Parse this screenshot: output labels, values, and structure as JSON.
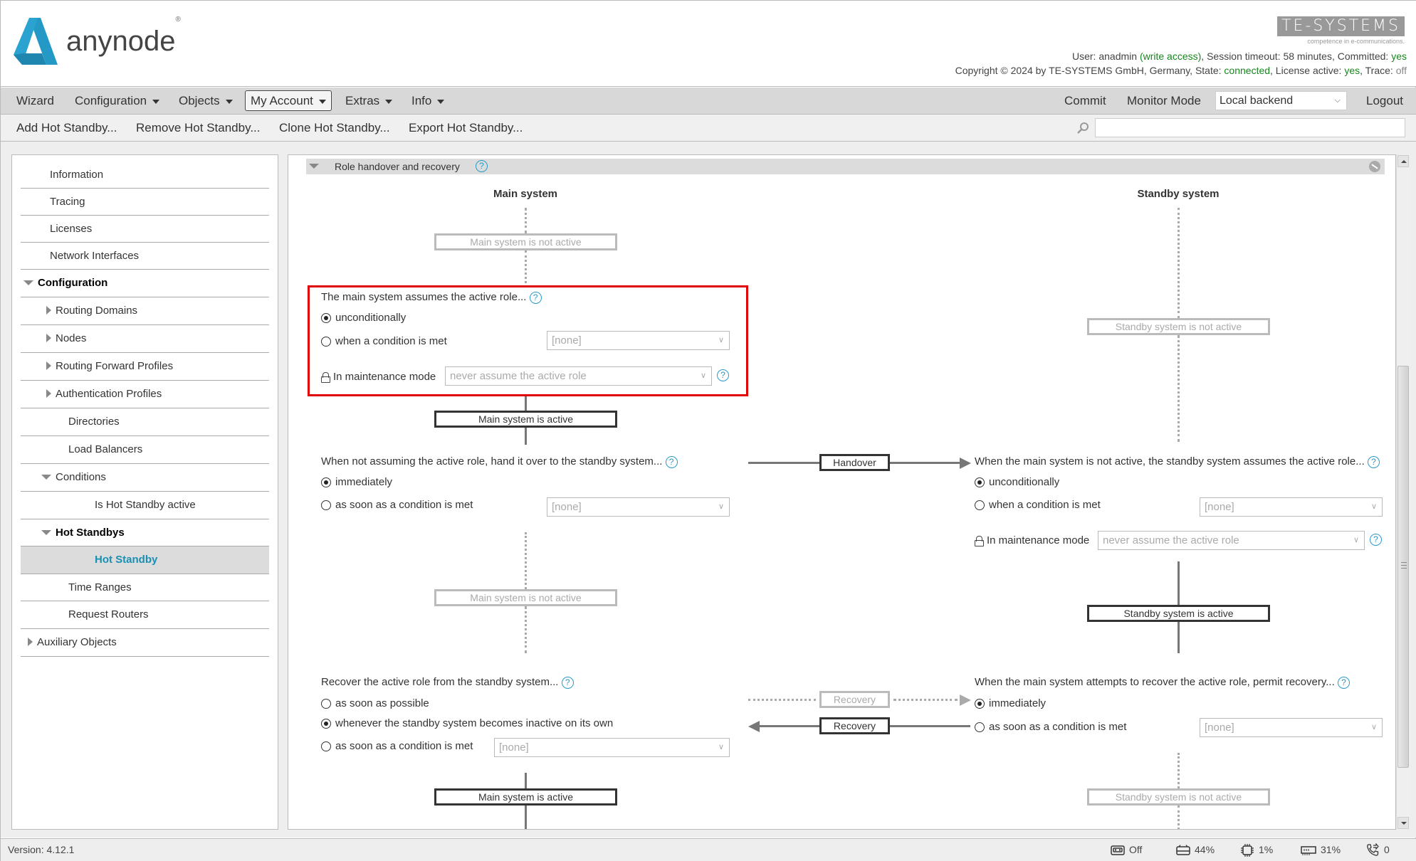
{
  "app": {
    "logo_text_bold": "any",
    "logo_text_light": "node",
    "logo_reg": "®",
    "brand_color": "#2499c6",
    "vendor_logo": "TE-SYSTEMS",
    "vendor_tagline": "competence in e-communications."
  },
  "session": {
    "user_label": "User: ",
    "user": "anadmin",
    "access": "(write access)",
    "timeout_label": ", Session timeout: ",
    "timeout": "58 minutes",
    "committed_label": ", Committed: ",
    "committed": "yes",
    "copyright": "Copyright © 2024 by TE-SYSTEMS GmbH, Germany, State: ",
    "state": "connected",
    "license_label": ", License active: ",
    "license": "yes",
    "trace_label": ", Trace: ",
    "trace": "off"
  },
  "menu": {
    "wizard": "Wizard",
    "configuration": "Configuration",
    "objects": "Objects",
    "my_account": "My Account",
    "extras": "Extras",
    "info": "Info",
    "commit": "Commit",
    "monitor_mode": "Monitor Mode",
    "backend": "Local backend",
    "logout": "Logout"
  },
  "toolbar": {
    "add": "Add Hot Standby...",
    "remove": "Remove Hot Standby...",
    "clone": "Clone Hot Standby...",
    "export": "Export Hot Standby...",
    "search_value": ""
  },
  "sidebar": {
    "items": [
      {
        "label": "Information"
      },
      {
        "label": "Tracing"
      },
      {
        "label": "Licenses"
      },
      {
        "label": "Network Interfaces"
      },
      {
        "label": "Configuration"
      },
      {
        "label": "Routing Domains"
      },
      {
        "label": "Nodes"
      },
      {
        "label": "Routing Forward Profiles"
      },
      {
        "label": "Authentication Profiles"
      },
      {
        "label": "Directories"
      },
      {
        "label": "Load Balancers"
      },
      {
        "label": "Conditions"
      },
      {
        "label": "Is Hot Standby active"
      },
      {
        "label": "Hot Standbys"
      },
      {
        "label": "Hot Standby"
      },
      {
        "label": "Time Ranges"
      },
      {
        "label": "Request Routers"
      },
      {
        "label": "Auxiliary Objects"
      }
    ],
    "selected": "Hot Standby"
  },
  "section": {
    "title": "Role handover and recovery",
    "help": "?"
  },
  "diagram": {
    "main_title": "Main system",
    "standby_title": "Standby system",
    "main_not_active": "Main system is not active",
    "main_active": "Main system is active",
    "standby_not_active": "Standby system is not active",
    "standby_active": "Standby system is active",
    "handover": "Handover",
    "recovery": "Recovery",
    "assume": {
      "question": "The main system assumes the active role...",
      "options": [
        "unconditionally",
        "when a condition is met"
      ],
      "selected": "unconditionally",
      "condition": "[none]",
      "maintenance_label": "In maintenance mode",
      "maintenance_value": "never assume the active role"
    },
    "handover_q": {
      "question": "When not assuming the active role, hand it over to the standby system...",
      "options": [
        "immediately",
        "as soon as a condition is met"
      ],
      "selected": "immediately",
      "condition": "[none]"
    },
    "standby_assume": {
      "question": "When the main system is not active, the standby system assumes the active role...",
      "options": [
        "unconditionally",
        "when a condition is met"
      ],
      "selected": "unconditionally",
      "condition": "[none]",
      "maintenance_label": "In maintenance mode",
      "maintenance_value": "never assume the active role"
    },
    "recover": {
      "question": "Recover the active role from the standby system...",
      "options": [
        "as soon as possible",
        "whenever the standby system becomes inactive on its own",
        "as soon as a condition is met"
      ],
      "selected": "whenever the standby system becomes inactive on its own",
      "condition": "[none]"
    },
    "permit": {
      "question": "When the main system attempts to recover the active role, permit recovery...",
      "options": [
        "immediately",
        "as soon as a condition is met"
      ],
      "selected": "immediately",
      "condition": "[none]"
    }
  },
  "statusbar": {
    "version_label": "Version:",
    "version": "4.12.1",
    "recording": "Off",
    "disk": "44%",
    "cpu": "1%",
    "memory": "31%",
    "calls": "0"
  },
  "colors": {
    "accent": "#2a9ac9",
    "green": "#17871d",
    "highlight": "#e00000",
    "selected_bg": "#dcdcdc"
  }
}
